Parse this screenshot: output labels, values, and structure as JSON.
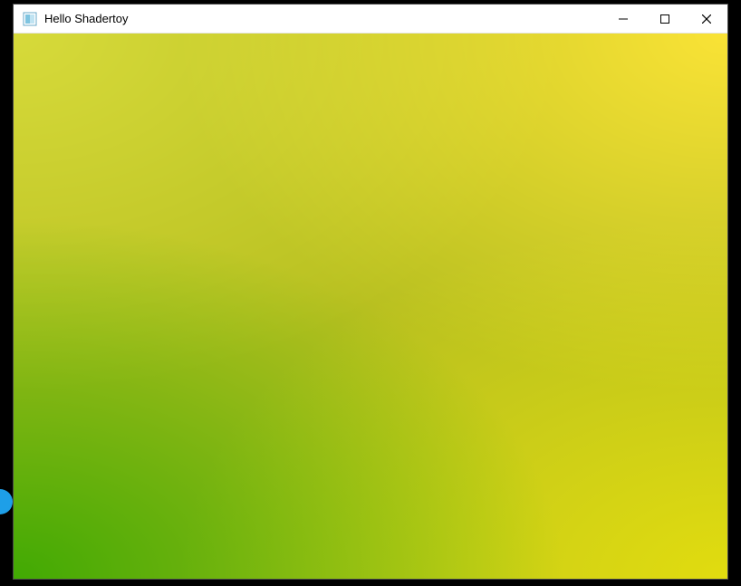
{
  "window": {
    "title": "Hello Shadertoy",
    "icon_name": "app-icon"
  },
  "controls": {
    "minimize_label": "Minimize",
    "maximize_label": "Maximize",
    "close_label": "Close"
  },
  "shader": {
    "corner_colors": {
      "top_left": "#6e691e",
      "top_right": "#eb8c19",
      "bottom_left": "#5ae119",
      "bottom_right": "#e1dc0f"
    }
  }
}
